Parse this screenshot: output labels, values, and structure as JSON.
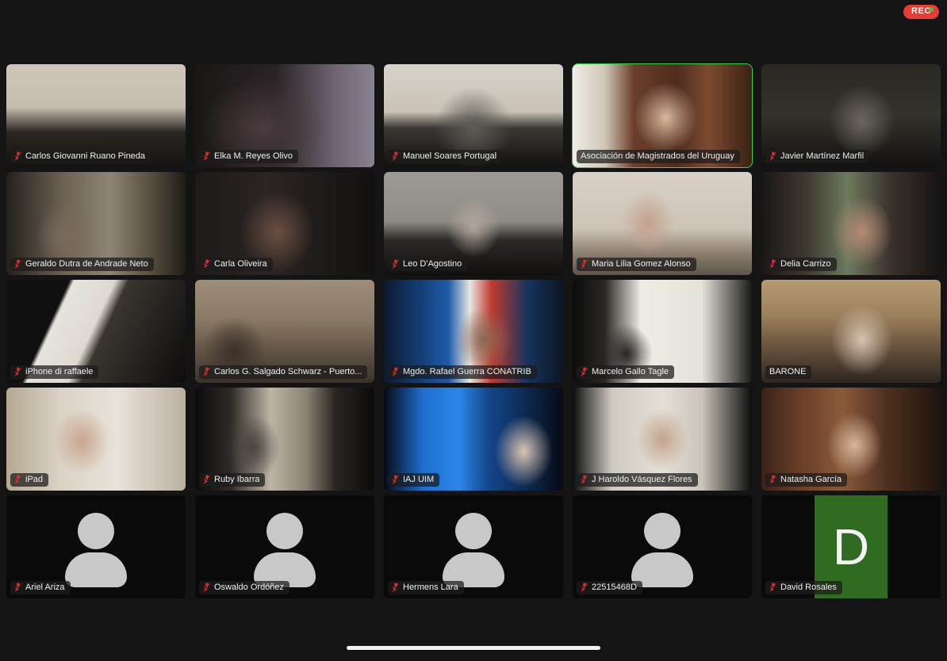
{
  "app": {
    "title": "Video Conference Gallery View",
    "background_color": "#141414"
  },
  "status": {
    "recording_label": "REC",
    "recording_color": "#eb3b35",
    "recording_dot_color": "#46c24a"
  },
  "colors": {
    "active_speaker_border": "#2fd44a",
    "mute_icon": "#ec2b2b",
    "nameplate_background": "rgba(28,28,28,0.74)",
    "initial_avatar_background": "#2f6b21"
  },
  "grid": {
    "columns": 5,
    "rows": 5,
    "participants": [
      {
        "name": "Carlos Giovanni Ruano Pineda",
        "muted": true,
        "active_speaker": false,
        "tile_type": "video",
        "scene": "man-dark-suit-flag"
      },
      {
        "name": "Elka M. Reyes Olivo",
        "muted": true,
        "active_speaker": false,
        "tile_type": "video",
        "scene": "woman-dark-room"
      },
      {
        "name": "Manuel Soares Portugal",
        "muted": true,
        "active_speaker": false,
        "tile_type": "video",
        "scene": "man-bookshelf-office"
      },
      {
        "name": "Asociación de Magistrados del Uruguay",
        "muted": false,
        "active_speaker": true,
        "tile_type": "video",
        "scene": "woman-speaking-wood-office"
      },
      {
        "name": "Javier Martínez Marfil",
        "muted": true,
        "active_speaker": false,
        "tile_type": "video",
        "scene": "man-dim-bookshelf"
      },
      {
        "name": "Geraldo Dutra de Andrade Neto",
        "muted": true,
        "active_speaker": false,
        "tile_type": "video",
        "scene": "man-library-background"
      },
      {
        "name": "Carla Oliveira",
        "muted": true,
        "active_speaker": false,
        "tile_type": "video",
        "scene": "woman-glasses-dark"
      },
      {
        "name": "Leo D'Agostino",
        "muted": true,
        "active_speaker": false,
        "tile_type": "video",
        "scene": "older-man-grey-wall"
      },
      {
        "name": "Maria Lilia Gomez Alonso",
        "muted": true,
        "active_speaker": false,
        "tile_type": "video",
        "scene": "woman-light-room"
      },
      {
        "name": "Delia Carrizo",
        "muted": true,
        "active_speaker": false,
        "tile_type": "video",
        "scene": "woman-statue-background"
      },
      {
        "name": "iPhone di raffaele",
        "muted": true,
        "active_speaker": false,
        "tile_type": "video",
        "scene": "man-tilted-camera-dark"
      },
      {
        "name": "Carlos G. Salgado Schwarz - Puerto...",
        "muted": true,
        "active_speaker": false,
        "tile_type": "video",
        "scene": "aerial-landscape-backdrop"
      },
      {
        "name": "Mgdo. Rafael Guerra CONATRIB",
        "muted": true,
        "active_speaker": false,
        "tile_type": "video",
        "scene": "man-mexican-flag"
      },
      {
        "name": "Marcelo Gallo Tagle",
        "muted": true,
        "active_speaker": false,
        "tile_type": "video",
        "scene": "man-white-wall-framed-art"
      },
      {
        "name": "BARONE",
        "muted": false,
        "active_speaker": false,
        "tile_type": "video",
        "scene": "man-ornate-hall"
      },
      {
        "name": "iPad",
        "muted": true,
        "active_speaker": false,
        "tile_type": "video",
        "scene": "woman-glasses-bright-room"
      },
      {
        "name": "Ruby Ibarra",
        "muted": true,
        "active_speaker": false,
        "tile_type": "video",
        "scene": "person-office-flag"
      },
      {
        "name": "IAJ UIM",
        "muted": true,
        "active_speaker": false,
        "tile_type": "video",
        "scene": "blue-scales-of-justice-logo"
      },
      {
        "name": "J Haroldo Vásquez Flores",
        "muted": true,
        "active_speaker": false,
        "tile_type": "video",
        "scene": "man-white-room"
      },
      {
        "name": "Natasha García",
        "muted": true,
        "active_speaker": false,
        "tile_type": "video",
        "scene": "woman-warm-interior"
      },
      {
        "name": "Ariel Ariza",
        "muted": true,
        "active_speaker": false,
        "tile_type": "silhouette",
        "scene": ""
      },
      {
        "name": "Oswaldo Ordóñez",
        "muted": true,
        "active_speaker": false,
        "tile_type": "silhouette",
        "scene": ""
      },
      {
        "name": "Hermens Lara",
        "muted": true,
        "active_speaker": false,
        "tile_type": "silhouette",
        "scene": ""
      },
      {
        "name": "22515468D",
        "muted": true,
        "active_speaker": false,
        "tile_type": "silhouette",
        "scene": ""
      },
      {
        "name": "David Rosales",
        "muted": true,
        "active_speaker": false,
        "tile_type": "initial",
        "initial": "D",
        "scene": ""
      }
    ]
  }
}
